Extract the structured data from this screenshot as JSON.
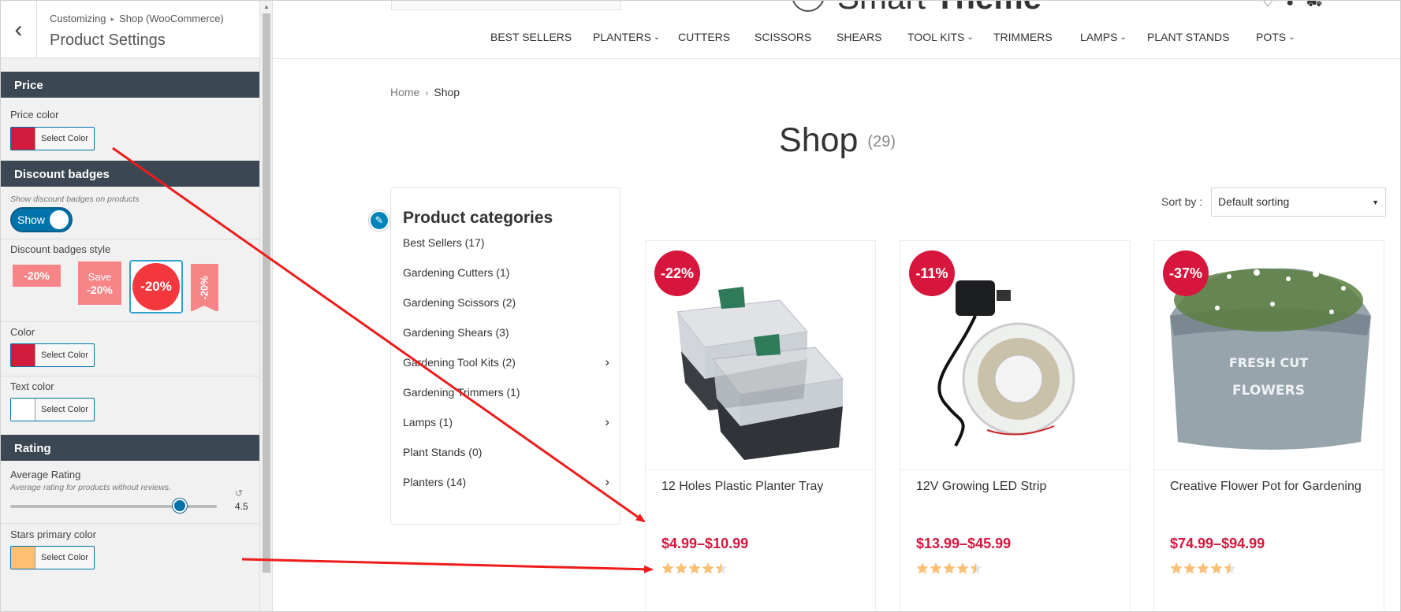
{
  "customizer": {
    "breadcrumb_parent": "Customizing",
    "breadcrumb_section": "Shop (WooCommerce)",
    "title": "Product Settings",
    "sections": {
      "price": {
        "heading": "Price",
        "price_color_label": "Price color",
        "price_color_swatch": "#d21b3d",
        "select_color": "Select Color"
      },
      "discount": {
        "heading": "Discount badges",
        "show_desc": "Show discount badges on products",
        "toggle_label": "Show",
        "style_label": "Discount badges style",
        "style1": "-20%",
        "style2_save": "Save",
        "style2_value": "-20%",
        "style3": "-20%",
        "style4": "-20%",
        "color_label": "Color",
        "color_swatch": "#d21b3d",
        "text_color_label": "Text color",
        "text_color_swatch": "#ffffff",
        "select_color": "Select Color"
      },
      "rating": {
        "heading": "Rating",
        "avg_label": "Average Rating",
        "avg_desc": "Average rating for products without reviews.",
        "avg_value": "4.5",
        "avg_level": 0.82,
        "stars_label": "Stars primary color",
        "stars_swatch": "#fcbf73",
        "select_color": "Select Color"
      }
    }
  },
  "preview": {
    "logo_light": "Smart ",
    "logo_bold": "Theme",
    "nav": [
      {
        "label": "BEST SELLERS",
        "dropdown": false
      },
      {
        "label": "PLANTERS",
        "dropdown": true
      },
      {
        "label": "CUTTERS",
        "dropdown": false
      },
      {
        "label": "SCISSORS",
        "dropdown": false
      },
      {
        "label": "SHEARS",
        "dropdown": false
      },
      {
        "label": "TOOL KITS",
        "dropdown": true
      },
      {
        "label": "TRIMMERS",
        "dropdown": false
      },
      {
        "label": "LAMPS",
        "dropdown": true
      },
      {
        "label": "PLANT STANDS",
        "dropdown": false
      },
      {
        "label": "POTS",
        "dropdown": true
      }
    ],
    "breadcrumb_home": "Home",
    "breadcrumb_current": "Shop",
    "shop_title": "Shop",
    "shop_count": "(29)",
    "categories_title": "Product categories",
    "categories": [
      {
        "label": "Best Sellers (17)",
        "has_children": false
      },
      {
        "label": "Gardening Cutters (1)",
        "has_children": false
      },
      {
        "label": "Gardening Scissors (2)",
        "has_children": false
      },
      {
        "label": "Gardening Shears (3)",
        "has_children": false
      },
      {
        "label": "Gardening Tool Kits (2)",
        "has_children": true
      },
      {
        "label": "Gardening Trimmers (1)",
        "has_children": false
      },
      {
        "label": "Lamps (1)",
        "has_children": true
      },
      {
        "label": "Plant Stands (0)",
        "has_children": false
      },
      {
        "label": "Planters (14)",
        "has_children": true
      }
    ],
    "sort_label": "Sort by :",
    "sort_value": "Default sorting",
    "products": [
      {
        "discount": "-22%",
        "name": "12 Holes Plastic Planter Tray",
        "price": "$4.99–$10.99",
        "rating": 4.5
      },
      {
        "discount": "-11%",
        "name": "12V Growing LED Strip",
        "price": "$13.99–$45.99",
        "rating": 4.5
      },
      {
        "discount": "-37%",
        "name": "Creative Flower Pot for Gardening",
        "price": "$74.99–$94.99",
        "rating": 4.5
      }
    ]
  },
  "colors": {
    "accent": "#d6163d",
    "toggle": "#0073aa",
    "section_header": "#3b4753",
    "star": "#fcbf73",
    "annotation_arrow": "#ee1c1c"
  }
}
